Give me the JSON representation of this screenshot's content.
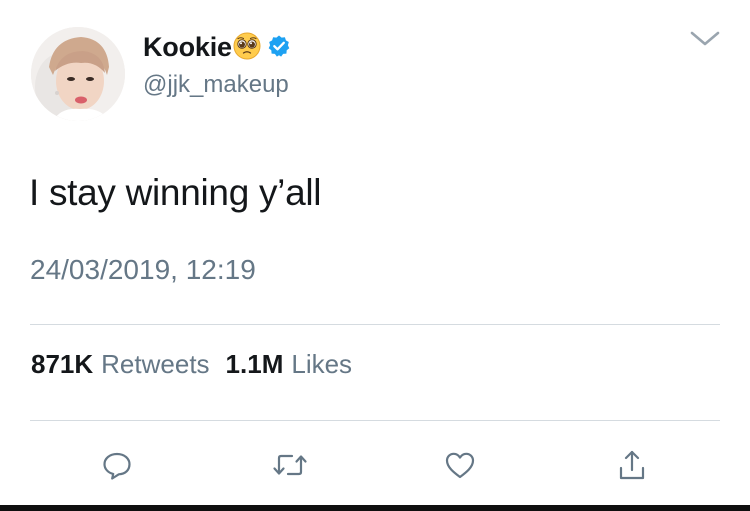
{
  "tweet": {
    "display_name": "Kookie",
    "handle": "@jjk_makeup",
    "text": "I stay winning y’all",
    "timestamp": "24/03/2019, 12:19"
  },
  "stats": {
    "retweets_count": "871K",
    "retweets_label": "Retweets",
    "likes_count": "1.1M",
    "likes_label": "Likes"
  },
  "icons": {
    "name_emoji": "pleading-face-icon",
    "verified": "verified-badge-icon",
    "menu": "chevron-down-icon",
    "reply": "reply-icon",
    "retweet": "retweet-icon",
    "like": "heart-icon",
    "share": "share-icon"
  },
  "colors": {
    "text_primary": "#14171a",
    "text_secondary": "#657786",
    "verified_blue": "#1da1f2",
    "icon_gray": "#657786",
    "divider": "#d5dbe0"
  }
}
